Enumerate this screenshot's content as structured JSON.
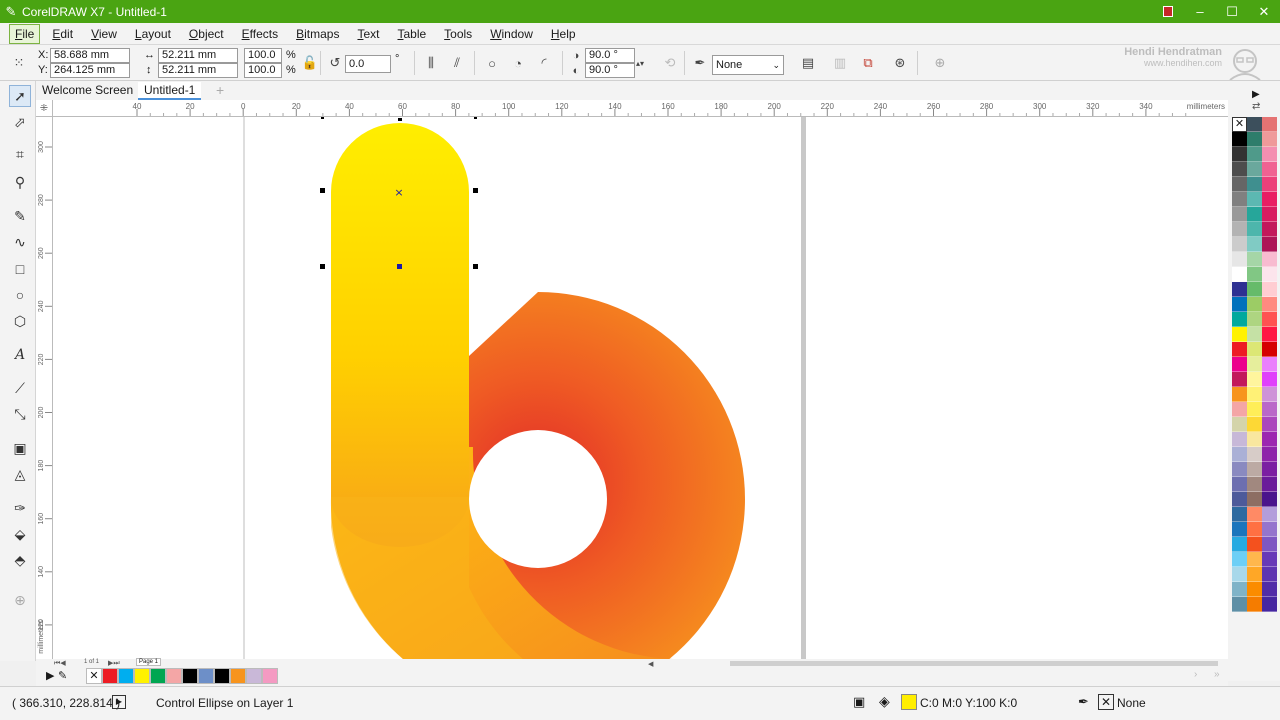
{
  "window": {
    "title": "CorelDRAW X7 - Untitled-1"
  },
  "menu": [
    "File",
    "Edit",
    "View",
    "Layout",
    "Object",
    "Effects",
    "Bitmaps",
    "Text",
    "Table",
    "Tools",
    "Window",
    "Help"
  ],
  "propbar": {
    "x_label": "X:",
    "x_value": "58.688 mm",
    "y_label": "Y:",
    "y_value": "264.125 mm",
    "width_value": "52.211 mm",
    "height_value": "52.211 mm",
    "scale_w": "100.0",
    "scale_h": "100.0",
    "pct": "%",
    "rotation": "0.0",
    "degree": "°",
    "start_angle": "90.0 °",
    "end_angle": "90.0 °",
    "outline": "None"
  },
  "watermark": {
    "name": "Hendi Hendratman",
    "site": "www.hendihen.com"
  },
  "tabs": {
    "welcome": "Welcome Screen",
    "doc": "Untitled-1"
  },
  "ruler": {
    "h_ticks": [
      "40",
      "20",
      "0",
      "20",
      "40",
      "60",
      "80",
      "100",
      "120",
      "140",
      "160",
      "180",
      "200",
      "220",
      "240",
      "260",
      "280",
      "300",
      "320",
      "340"
    ],
    "units": "millimeters",
    "v_ticks": [
      "300",
      "280",
      "260",
      "240",
      "220",
      "200",
      "180",
      "160",
      "140",
      "120"
    ],
    "v_units": "millimeters"
  },
  "pager": {
    "page": "Page 1",
    "counter": "1 of 1"
  },
  "status": {
    "coords": "( 366.310, 228.814 )",
    "message": "Control Ellipse on Layer 1",
    "fill_info": "C:0 M:0 Y:100 K:0",
    "outline_info": "None"
  },
  "colors": {
    "titlebar": "#4aa412",
    "fill_yellow": "#ffee00",
    "gradient_red": "#e53935",
    "gradient_orange": "#f7941d",
    "handle_blue": "#1a1aa8"
  },
  "palette_right": [
    [
      "#ffffff",
      "#000000",
      "#333333",
      "#4d4d4d",
      "#666666",
      "#808080",
      "#999999",
      "#b3b3b3",
      "#cccccc",
      "#e6e6e6",
      "#ffffff",
      "#2e3192",
      "#0071bc",
      "#00a99d",
      "#fff200",
      "#ed1c24",
      "#ec008c",
      "#c2185b",
      "#f7941d",
      "#f4a6a6",
      "#d4d4aa",
      "#c7b8d8",
      "#aab0d6",
      "#8a8ac0",
      "#6d6fb0",
      "#4d5a9a",
      "#2d6aa0",
      "#1b75bc",
      "#27aae1",
      "#6dcff6",
      "#a8d8ea",
      "#7fb3c8",
      "#5e8fa6"
    ],
    [
      "#3c4f5c",
      "#2e7d6b",
      "#4f9a8a",
      "#6aa89d",
      "#3f8f8f",
      "#5cb8b2",
      "#26a69a",
      "#4db6ac",
      "#80cbc4",
      "#a5d6a7",
      "#81c784",
      "#66bb6a",
      "#9ccc65",
      "#aed581",
      "#c5e1a5",
      "#dce775",
      "#e6ee9c",
      "#fff59d",
      "#fff176",
      "#ffee58",
      "#fdd835",
      "#f9e79f",
      "#d7ccc8",
      "#bcaaa4",
      "#a1887f",
      "#8d6e63",
      "#ff8a65",
      "#ff7043",
      "#f4511e",
      "#ffb74d",
      "#ffa726",
      "#fb8c00",
      "#f57c00"
    ],
    [
      "#e57373",
      "#ef9a9a",
      "#f48fb1",
      "#f06292",
      "#ec407a",
      "#e91e63",
      "#d81b60",
      "#c2185b",
      "#ad1457",
      "#f8bbd0",
      "#fce4ec",
      "#ffcdd2",
      "#ff8a80",
      "#ff5252",
      "#ff1744",
      "#d50000",
      "#ea80fc",
      "#e040fb",
      "#ce93d8",
      "#ba68c8",
      "#ab47bc",
      "#9c27b0",
      "#8e24aa",
      "#7b1fa2",
      "#6a1b9a",
      "#4a148c",
      "#b39ddb",
      "#9575cd",
      "#7e57c2",
      "#673ab7",
      "#5e35b1",
      "#512da8",
      "#4527a0"
    ]
  ],
  "palette_bottom": [
    "#ed1c24",
    "#00aeef",
    "#fff200",
    "#00a651",
    "#f4a6a6",
    "#000000",
    "#6d8fc8",
    "#000000",
    "#f7941d",
    "#c9b8d8",
    "#f49ac2"
  ]
}
